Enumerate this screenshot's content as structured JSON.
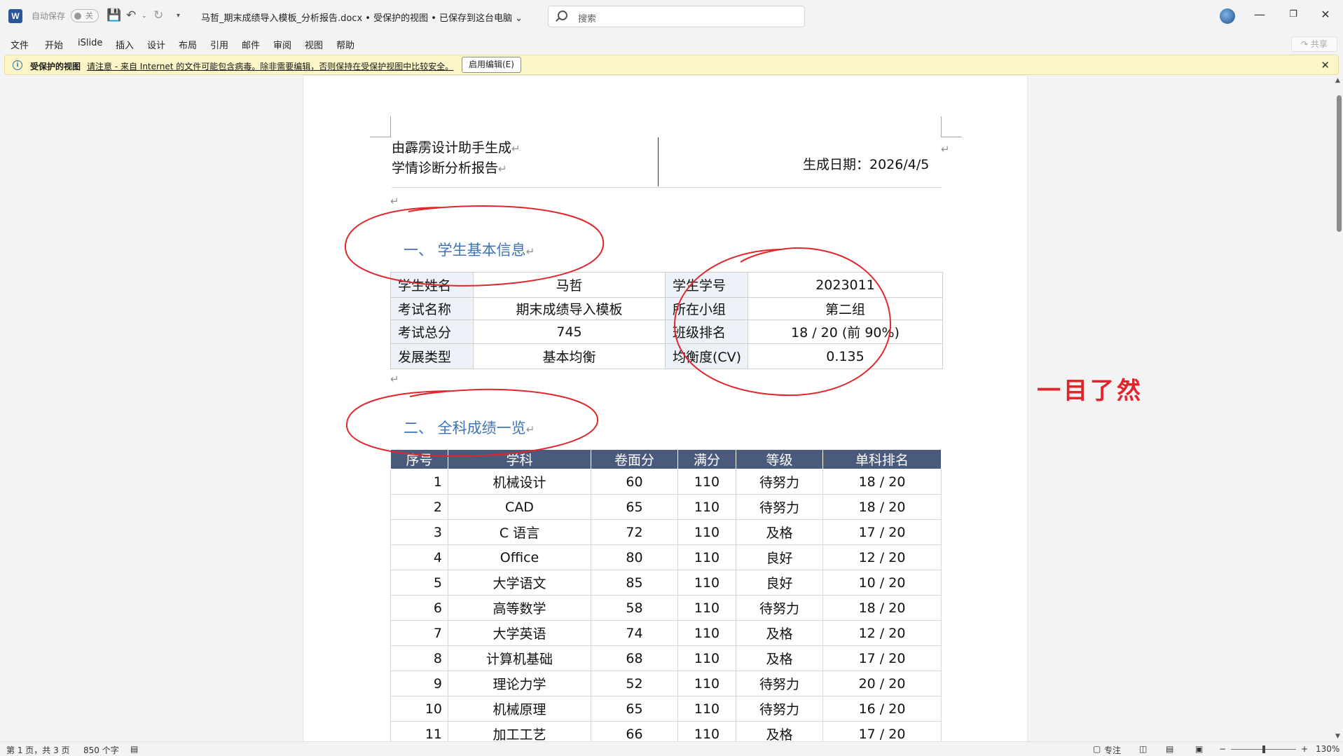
{
  "titlebar": {
    "autosave_label": "自动保存",
    "autosave_state": "关",
    "document_title": "马哲_期末成绩导入模板_分析报告.docx  •  受保护的视图 • 已保存到这台电脑 ⌄",
    "search_placeholder": "搜索",
    "icons": [
      "word-logo",
      "save-icon",
      "undo-icon",
      "redo-icon",
      "customize-icon",
      "search-icon",
      "avatar",
      "minimize-icon",
      "maximize-icon",
      "close-icon"
    ]
  },
  "menu": [
    "文件",
    "开始",
    "iSlide",
    "插入",
    "设计",
    "布局",
    "引用",
    "邮件",
    "审阅",
    "视图",
    "帮助"
  ],
  "share_label": "共享",
  "protected_bar": {
    "title": "受保护的视图",
    "message": "请注意 - 来自 Internet 的文件可能包含病毒。除非需要编辑，否则保持在受保护视图中比较安全。",
    "enable_button": "启用编辑(E)"
  },
  "document": {
    "header_line1": "由霹雳设计助手生成",
    "header_line2": "学情诊断分析报告",
    "header_date": "生成日期：2026/4/5",
    "section1_title": "一、 学生基本信息",
    "student_info": [
      {
        "k1": "学生姓名",
        "v1": "马哲",
        "k2": "学生学号",
        "v2": "2023011"
      },
      {
        "k1": "考试名称",
        "v1": "期末成绩导入模板",
        "k2": "所在小组",
        "v2": "第二组"
      },
      {
        "k1": "考试总分",
        "v1": "745",
        "k2": "班级排名",
        "v2": "18 / 20 (前 90%)"
      },
      {
        "k1": "发展类型",
        "v1": "基本均衡",
        "k2": "均衡度(CV)",
        "v2": "0.135"
      }
    ],
    "section2_title": "二、 全科成绩一览",
    "score_headers": [
      "序号",
      "学科",
      "卷面分",
      "满分",
      "等级",
      "单科排名"
    ],
    "scores": [
      {
        "no": "1",
        "subject": "机械设计",
        "score": "60",
        "full": "110",
        "grade": "待努力",
        "rank": "18 / 20"
      },
      {
        "no": "2",
        "subject": "CAD",
        "score": "65",
        "full": "110",
        "grade": "待努力",
        "rank": "18 / 20"
      },
      {
        "no": "3",
        "subject": "C 语言",
        "score": "72",
        "full": "110",
        "grade": "及格",
        "rank": "17 / 20"
      },
      {
        "no": "4",
        "subject": "Office",
        "score": "80",
        "full": "110",
        "grade": "良好",
        "rank": "12 / 20"
      },
      {
        "no": "5",
        "subject": "大学语文",
        "score": "85",
        "full": "110",
        "grade": "良好",
        "rank": "10 / 20"
      },
      {
        "no": "6",
        "subject": "高等数学",
        "score": "58",
        "full": "110",
        "grade": "待努力",
        "rank": "18 / 20"
      },
      {
        "no": "7",
        "subject": "大学英语",
        "score": "74",
        "full": "110",
        "grade": "及格",
        "rank": "12 / 20"
      },
      {
        "no": "8",
        "subject": "计算机基础",
        "score": "68",
        "full": "110",
        "grade": "及格",
        "rank": "17 / 20"
      },
      {
        "no": "9",
        "subject": "理论力学",
        "score": "52",
        "full": "110",
        "grade": "待努力",
        "rank": "20 / 20"
      },
      {
        "no": "10",
        "subject": "机械原理",
        "score": "65",
        "full": "110",
        "grade": "待努力",
        "rank": "16 / 20"
      },
      {
        "no": "11",
        "subject": "加工工艺",
        "score": "66",
        "full": "110",
        "grade": "及格",
        "rank": "17 / 20"
      }
    ],
    "annotation_note": "一目了然"
  },
  "statusbar": {
    "page_info": "第 1 页，共 3 页",
    "word_count": "850 个字",
    "focus_label": "专注",
    "zoom_level": "130%"
  },
  "colors": {
    "accent": "#2b579a",
    "heading": "#3d73b9",
    "table_header": "#4a5a7d",
    "ink": "#e0262b",
    "protected_bar": "#fcf5c8"
  }
}
